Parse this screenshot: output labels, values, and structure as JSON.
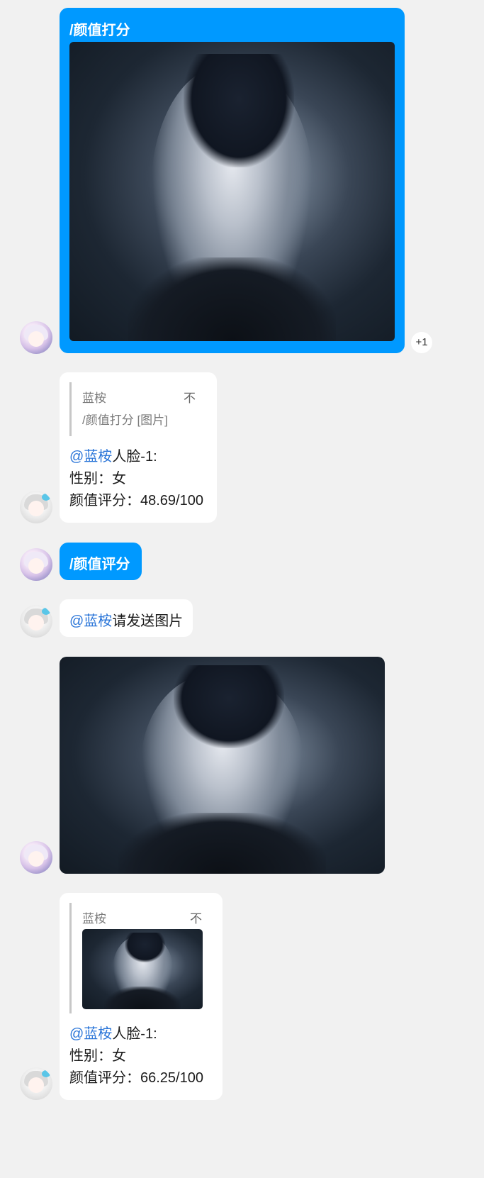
{
  "messages": [
    {
      "command": "/颜值打分",
      "reaction": "+1"
    },
    {
      "quote": {
        "author": "蓝桉",
        "corner_glyph": "不",
        "text": "/颜值打分 [图片]"
      },
      "mention": "@蓝桉",
      "lines": [
        "人脸-1:",
        "性别：女",
        "颜值评分：48.69/100"
      ]
    },
    {
      "command": "/颜值评分"
    },
    {
      "mention": "@蓝桉",
      "text": "请发送图片"
    },
    {
      "quote": {
        "author": "蓝桉",
        "corner_glyph": "不"
      },
      "mention": "@蓝桉",
      "lines": [
        "人脸-1:",
        "性别：女",
        "颜值评分：66.25/100"
      ]
    }
  ]
}
